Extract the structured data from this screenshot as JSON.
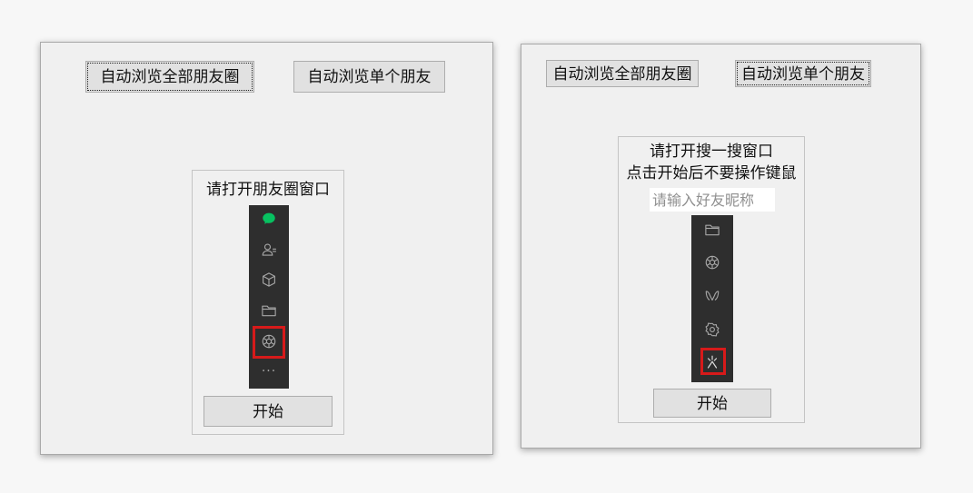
{
  "left_window": {
    "tab_all_label": "自动浏览全部朋友圈",
    "tab_single_label": "自动浏览单个朋友",
    "instruction": "请打开朋友圈窗口",
    "start_label": "开始",
    "sidebar_icons": [
      "chat-icon",
      "contacts-icon",
      "box-icon",
      "folder-icon",
      "moments-icon",
      "more-icon"
    ],
    "highlighted_icon": "moments-icon",
    "more_glyph": "···"
  },
  "right_window": {
    "tab_all_label": "自动浏览全部朋友圈",
    "tab_single_label": "自动浏览单个朋友",
    "instruction_line1": "请打开搜一搜窗口",
    "instruction_line2": "点击开始后不要操作键鼠",
    "nickname_placeholder": "请输入好友昵称",
    "nickname_value": "",
    "start_label": "开始",
    "sidebar_icons": [
      "folder-icon",
      "moments-icon",
      "channels-icon",
      "miniprogram-icon",
      "search-icon"
    ],
    "highlighted_icon": "search-icon"
  },
  "colors": {
    "window_bg": "#f0f0f0",
    "button_bg": "#e1e1e1",
    "sidebar_bg": "#2e2e2e",
    "sidebar_icon": "#a7a7a7",
    "chat_active": "#07c160",
    "highlight": "#d71a1a"
  }
}
